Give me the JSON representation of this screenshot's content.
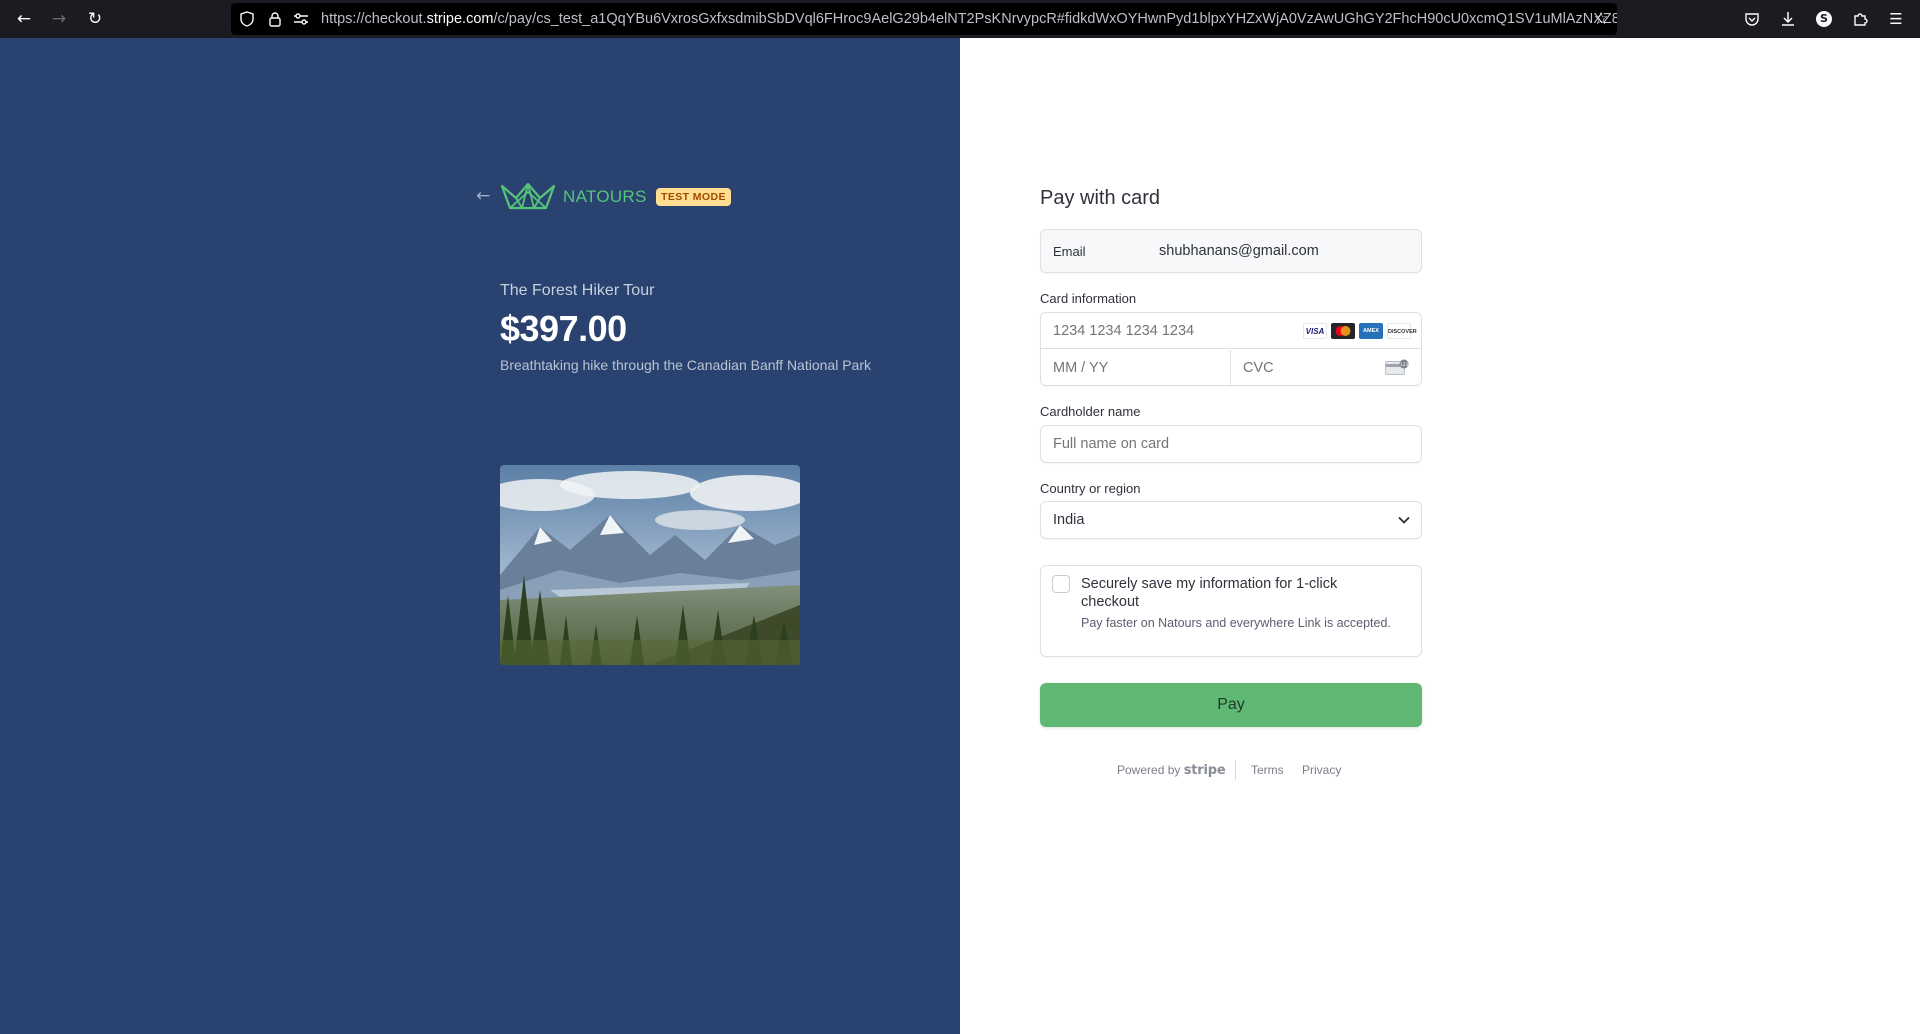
{
  "browser": {
    "url_host": "https://checkout.stripe.com",
    "url_path": "/c/pay/cs_test_a1QqYBu6VxrosGxfxsdmibSbDVql6FHroc9AelG29b4elNT2PsKNrvypcR#fidkdWxOYHwnPyd1blpxYHZxWjA0VzAwUGhGY2FhcH90cU0xcmQ1SV1uMlAzNXZ8",
    "url_host_bold": "stripe.com",
    "url_prefix": "https://checkout.",
    "icons": [
      "back-icon",
      "forward-icon",
      "reload-icon",
      "shield-icon",
      "lock-icon",
      "permissions-icon",
      "star-icon",
      "pocket-icon",
      "download-icon",
      "account-icon",
      "extensions-icon",
      "menu-icon"
    ]
  },
  "merchant": {
    "name": "NATOURS",
    "test_badge": "TEST MODE",
    "brand_color": "#55c57a"
  },
  "product": {
    "name": "The Forest Hiker Tour",
    "price": "$397.00",
    "description": "Breathtaking hike through the Canadian Banff National Park"
  },
  "form": {
    "title": "Pay with card",
    "email_label": "Email",
    "email_value": "shubhanans@gmail.com",
    "card_label": "Card information",
    "card_number_placeholder": "1234 1234 1234 1234",
    "expiry_placeholder": "MM / YY",
    "cvc_placeholder": "CVC",
    "card_brands": [
      "VISA",
      "mastercard",
      "AMEX",
      "DISCOVER"
    ],
    "cardholder_label": "Cardholder name",
    "cardholder_placeholder": "Full name on card",
    "country_label": "Country or region",
    "country_value": "India",
    "save_title": "Securely save my information for 1-click checkout",
    "save_description": "Pay faster on Natours and everywhere Link is accepted.",
    "pay_label": "Pay"
  },
  "footer": {
    "powered_by": "Powered by",
    "stripe": "stripe",
    "terms": "Terms",
    "privacy": "Privacy"
  },
  "colors": {
    "left_bg": "#2a426f",
    "pay_button": "#5fb873",
    "badge_bg": "#ffde92",
    "badge_text": "#a04b00"
  }
}
